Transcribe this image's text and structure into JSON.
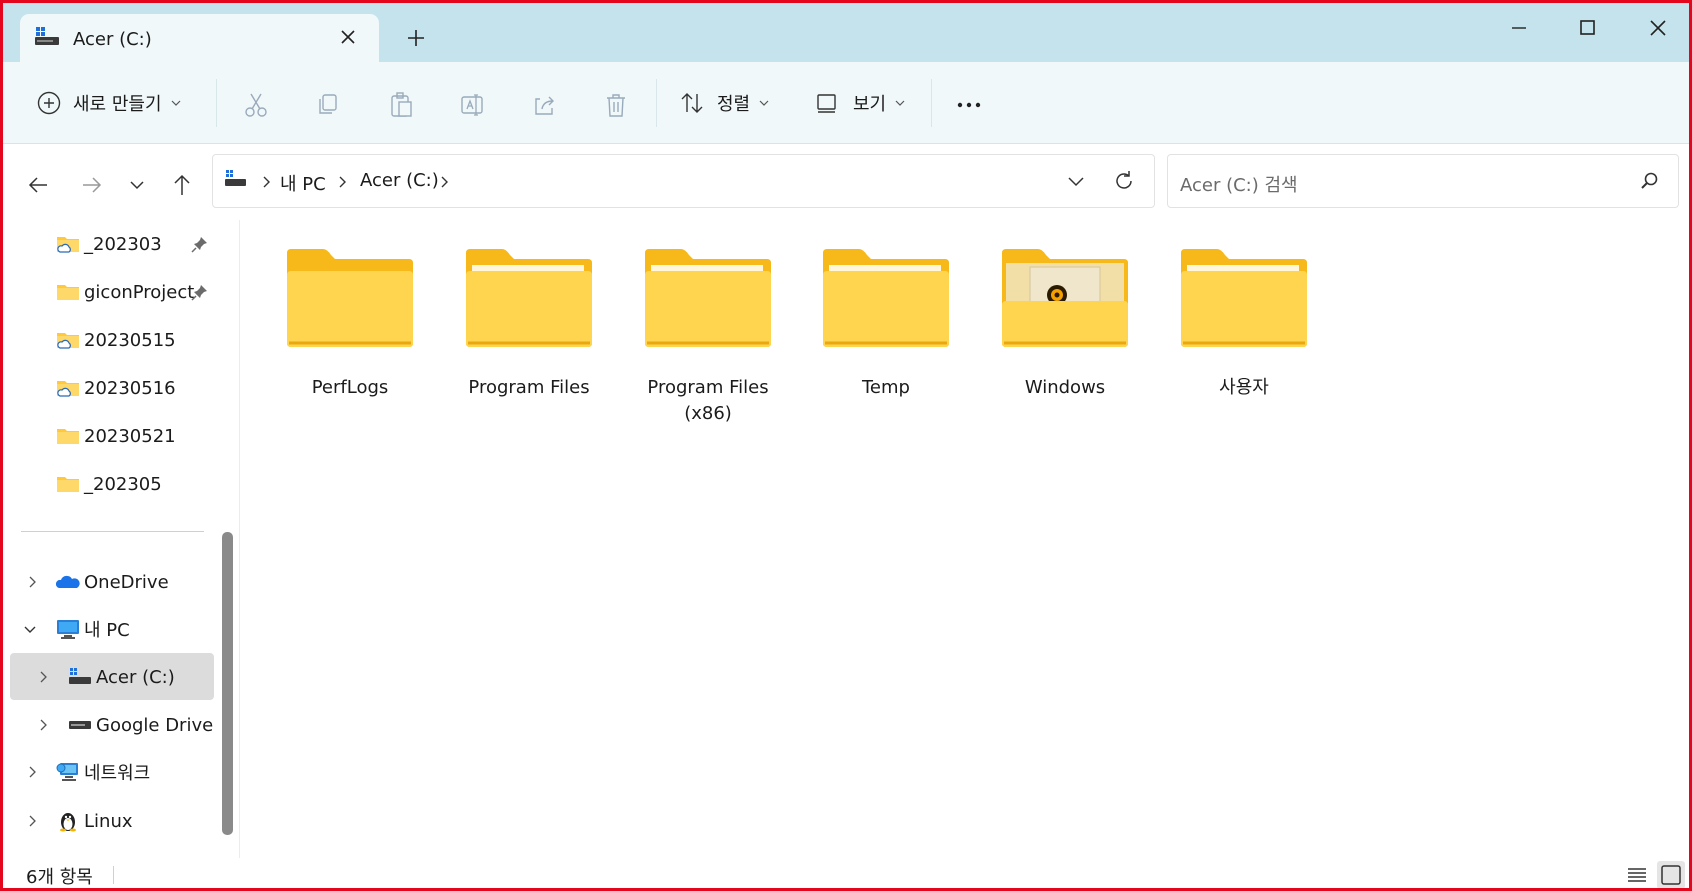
{
  "window": {
    "tab_title": "Acer (C:)"
  },
  "toolbar": {
    "new_label": "새로 만들기",
    "sort_label": "정렬",
    "view_label": "보기"
  },
  "address": {
    "crumbs": [
      "내 PC",
      "Acer (C:)"
    ]
  },
  "search": {
    "placeholder": "Acer (C:) 검색"
  },
  "sidebar": {
    "quick": [
      {
        "label": "_202303",
        "icon": "folder-cloud-icon",
        "pinned": true
      },
      {
        "label": "giconProject",
        "icon": "folder-icon",
        "pinned": true
      },
      {
        "label": "20230515",
        "icon": "folder-cloud-icon",
        "pinned": false
      },
      {
        "label": "20230516",
        "icon": "folder-cloud-icon",
        "pinned": false
      },
      {
        "label": "20230521",
        "icon": "folder-icon",
        "pinned": false
      },
      {
        "label": "_202305",
        "icon": "folder-icon",
        "pinned": false
      }
    ],
    "tree": [
      {
        "label": "OneDrive",
        "icon": "onedrive-icon"
      },
      {
        "label": "내 PC",
        "icon": "pc-icon"
      },
      {
        "label": "Acer (C:)",
        "icon": "drive-c-icon"
      },
      {
        "label": "Google Drive (",
        "icon": "drive-icon"
      },
      {
        "label": "네트워크",
        "icon": "network-icon"
      },
      {
        "label": "Linux",
        "icon": "linux-icon"
      }
    ]
  },
  "content": {
    "items": [
      {
        "name": "PerfLogs",
        "icon": "folder-icon"
      },
      {
        "name": "Program Files",
        "icon": "folder-icon"
      },
      {
        "name": "Program Files (x86)",
        "icon": "folder-icon"
      },
      {
        "name": "Temp",
        "icon": "folder-icon"
      },
      {
        "name": "Windows",
        "icon": "windows-folder-icon"
      },
      {
        "name": "사용자",
        "icon": "folder-icon"
      }
    ]
  },
  "status": {
    "count": "6개 항목"
  },
  "colors": {
    "frame": "#e3061d",
    "titlebar": "#c5e3ec",
    "toolbar": "#f0f8fa",
    "folder": "#ffd54f"
  }
}
